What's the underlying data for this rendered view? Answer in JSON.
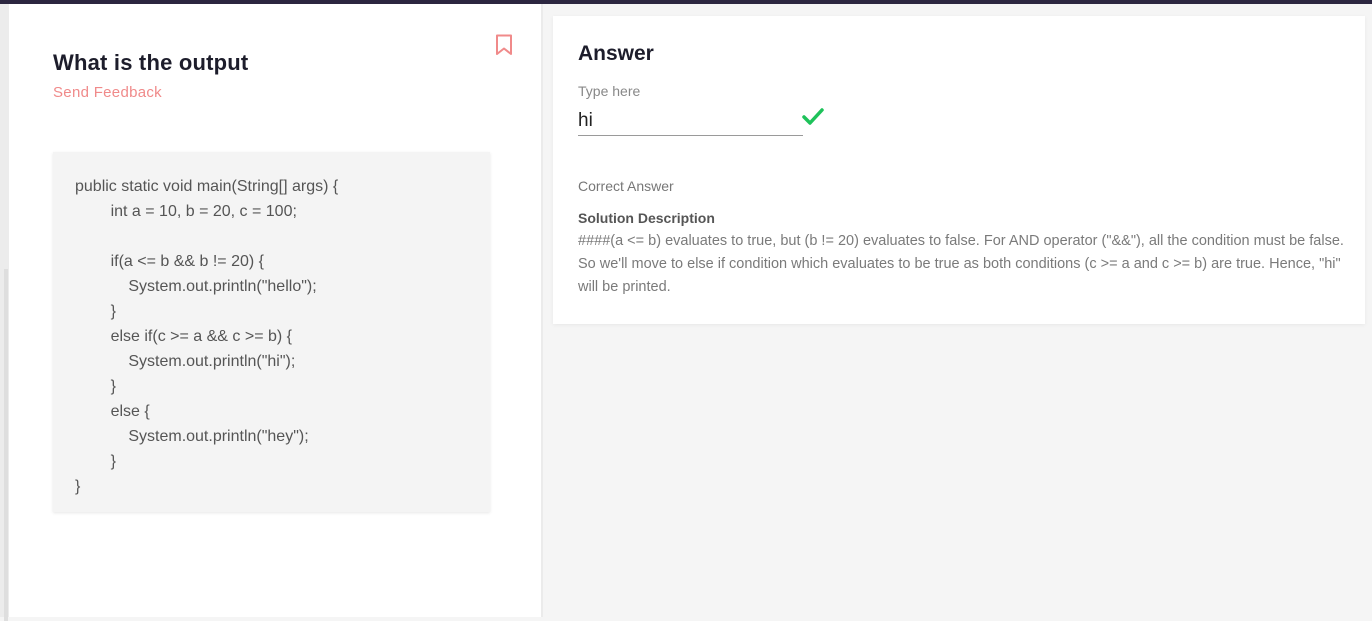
{
  "question": {
    "title": "What is the output",
    "feedback_label": "Send Feedback",
    "code_lines": [
      "public static void main(String[] args) {",
      "        int a = 10, b = 20, c = 100;",
      "",
      "        if(a <= b && b != 20) {",
      "            System.out.println(\"hello\");",
      "        }",
      "        else if(c >= a && c >= b) {",
      "            System.out.println(\"hi\");",
      "        }",
      "        else {",
      "            System.out.println(\"hey\");",
      "        }",
      "}"
    ]
  },
  "answer": {
    "title": "Answer",
    "input_label": "Type here",
    "input_value": "hi",
    "correct_label": "Correct Answer",
    "solution_title": "Solution Description",
    "solution_text": "####(a <= b) evaluates to true, but (b != 20) evaluates to false. For AND operator (\"&&\"), all the condition must be false. So we'll move to else if condition which evaluates to be true as both conditions (c >= a and c >= b) are true. Hence, \"hi\" will be printed."
  },
  "colors": {
    "accent": "#f08a8a",
    "success": "#1ec25a",
    "top_bar": "#2c2640"
  },
  "icons": {
    "bookmark": "bookmark-icon",
    "check": "check-icon"
  }
}
